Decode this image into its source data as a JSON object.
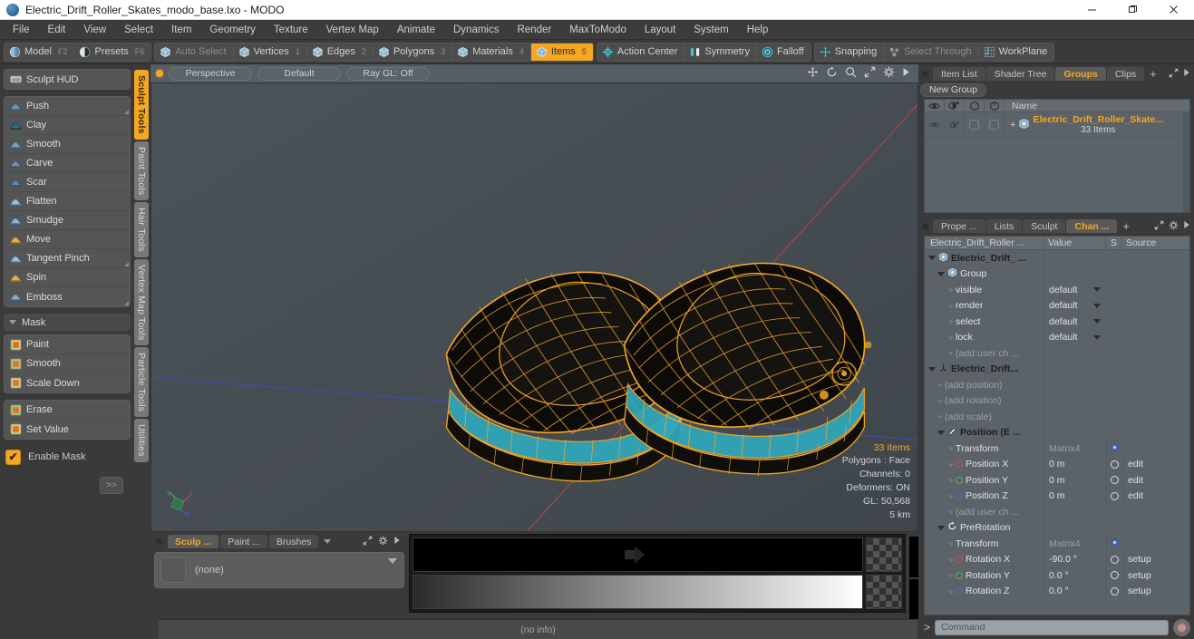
{
  "window": {
    "title": "Electric_Drift_Roller_Skates_modo_base.lxo - MODO",
    "minimize": "─",
    "maximize": "❐",
    "close": "✕"
  },
  "menubar": {
    "items": [
      "File",
      "Edit",
      "View",
      "Select",
      "Item",
      "Geometry",
      "Texture",
      "Vertex Map",
      "Animate",
      "Dynamics",
      "Render",
      "MaxToModo",
      "Layout",
      "System",
      "Help"
    ]
  },
  "toolbar": {
    "group_mode": [
      {
        "label": "Model",
        "key": "F2",
        "icon": "sphere-icon",
        "active": false
      },
      {
        "label": "Presets",
        "key": "F6",
        "icon": "half-sphere-icon",
        "active": false
      }
    ],
    "group_select": [
      {
        "label": "Auto Select",
        "key": "",
        "icon": "cube-icon",
        "active": false,
        "dim": true
      },
      {
        "label": "Vertices",
        "key": "1",
        "icon": "cube-icon",
        "active": false
      },
      {
        "label": "Edges",
        "key": "2",
        "icon": "cube-icon",
        "active": false
      },
      {
        "label": "Polygons",
        "key": "3",
        "icon": "cube-icon",
        "active": false
      },
      {
        "label": "Materials",
        "key": "4",
        "icon": "cube-icon",
        "active": false
      },
      {
        "label": "Items",
        "key": "5",
        "icon": "cube-icon",
        "active": true
      }
    ],
    "group_center": [
      {
        "label": "Action Center",
        "key": "",
        "icon": "crosshair-icon",
        "active": false
      },
      {
        "label": "Symmetry",
        "key": "",
        "icon": "mirror-icon",
        "active": false
      },
      {
        "label": "Falloff",
        "key": "",
        "icon": "target-icon",
        "active": false
      }
    ],
    "group_snap": [
      {
        "label": "Snapping",
        "key": "",
        "icon": "snap-icon",
        "active": false
      },
      {
        "label": "Select Through",
        "key": "",
        "icon": "molecule-icon",
        "active": false,
        "dim": true
      },
      {
        "label": "WorkPlane",
        "key": "",
        "icon": "grid-icon",
        "active": false
      }
    ]
  },
  "sculpt_panel": {
    "hud_label": "Sculpt HUD",
    "brushes": [
      {
        "label": "Push",
        "icon": "push-brush-icon",
        "corner": true
      },
      {
        "label": "Clay",
        "icon": "clay-brush-icon",
        "corner": false
      },
      {
        "label": "Smooth",
        "icon": "smooth-brush-icon",
        "corner": false
      },
      {
        "label": "Carve",
        "icon": "carve-brush-icon",
        "corner": false
      },
      {
        "label": "Scar",
        "icon": "scar-brush-icon",
        "corner": false
      },
      {
        "label": "Flatten",
        "icon": "flatten-brush-icon",
        "corner": false
      },
      {
        "label": "Smudge",
        "icon": "smudge-brush-icon",
        "corner": false
      },
      {
        "label": "Move",
        "icon": "move-brush-icon",
        "corner": false
      },
      {
        "label": "Tangent Pinch",
        "icon": "pinch-brush-icon",
        "corner": true
      },
      {
        "label": "Spin",
        "icon": "spin-brush-icon",
        "corner": false
      },
      {
        "label": "Emboss",
        "icon": "emboss-brush-icon",
        "corner": true
      }
    ],
    "mask_section": "Mask",
    "mask_group1": [
      {
        "label": "Paint",
        "icon": "mask-paint-icon"
      },
      {
        "label": "Smooth",
        "icon": "mask-smooth-icon"
      },
      {
        "label": "Scale Down",
        "icon": "mask-scale-icon"
      }
    ],
    "mask_group2": [
      {
        "label": "Erase",
        "icon": "mask-erase-icon"
      },
      {
        "label": "Set Value",
        "icon": "mask-setvalue-icon"
      }
    ],
    "enable_mask": {
      "label": "Enable Mask",
      "checked": true,
      "check_glyph": "✔"
    },
    "expand_label": ">>"
  },
  "vertical_tabs": [
    {
      "label": "Sculpt Tools",
      "active": true
    },
    {
      "label": "Paint Tools",
      "active": false
    },
    {
      "label": "Hair Tools",
      "active": false
    },
    {
      "label": "Vertex Map Tools",
      "active": false
    },
    {
      "label": "Particle Tools",
      "active": false
    },
    {
      "label": "Utilities",
      "active": false
    }
  ],
  "viewport": {
    "header": {
      "view_mode": "Perspective",
      "shading": "Default",
      "ray_gl": "Ray GL: Off",
      "icons": [
        "move-icon",
        "rotate-icon",
        "zoom-icon",
        "fit-icon",
        "gear-icon",
        "play-icon"
      ]
    },
    "stats": {
      "items": "33 Items",
      "polygons": "Polygons : Face",
      "channels": "Channels: 0",
      "deformers": "Deformers: ON",
      "gl": "GL: 50,568",
      "scale": "5 km"
    },
    "gizmo_axes": [
      "X",
      "Y",
      "Z"
    ],
    "colors": {
      "background": "#464d53",
      "wireframe_selected": "#f5a623",
      "wireframe_accent": "#3fc8d8",
      "axis_x": "#b34a4a",
      "axis_z": "#4a5ab3"
    },
    "model_description": "Electric Drift Roller Skates - wireframe pair of skates"
  },
  "bottom_panel": {
    "tabs": [
      {
        "label": "Sculp ...",
        "active": true
      },
      {
        "label": "Paint ...",
        "active": false
      },
      {
        "label": "Brushes",
        "active": false
      }
    ],
    "brush_value": "(none)",
    "status": "(no info)"
  },
  "right_panel": {
    "top_tabs": [
      {
        "label": "Item List",
        "active": false
      },
      {
        "label": "Shader Tree",
        "active": false
      },
      {
        "label": "Groups",
        "active": true
      },
      {
        "label": "Clips",
        "active": false
      }
    ],
    "new_group_button": "New Group",
    "group_list": {
      "columns": [
        "eye-icon",
        "render-icon",
        "select-icon",
        "lock-icon"
      ],
      "name_header": "Name",
      "rows": [
        {
          "name": "Electric_Drift_Roller_Skate...",
          "sub": "33 Items",
          "expander": "+"
        }
      ]
    },
    "bottom_tabs": [
      {
        "label": "Prope ...",
        "active": false
      },
      {
        "label": "Lists",
        "active": false
      },
      {
        "label": "Sculpt",
        "active": false
      },
      {
        "label": "Chan ...",
        "active": true
      }
    ],
    "channels": {
      "headers": [
        "Electric_Drift_Roller ...",
        "Value",
        "S",
        "Source"
      ],
      "rows": [
        {
          "indent": 1,
          "tri": "down",
          "icon": "group-icon",
          "name": "Electric_Drift_ ...",
          "value": "",
          "s": "",
          "source": "",
          "bold": true
        },
        {
          "indent": 2,
          "tri": "down",
          "icon": "group-icon",
          "name": "Group",
          "value": "",
          "s": "",
          "source": "",
          "bold": false
        },
        {
          "indent": 3,
          "tri": "dash",
          "icon": "",
          "name": "visible",
          "value": "default",
          "dropdown": true,
          "s": "",
          "source": ""
        },
        {
          "indent": 3,
          "tri": "dash",
          "icon": "",
          "name": "render",
          "value": "default",
          "dropdown": true,
          "s": "",
          "source": ""
        },
        {
          "indent": 3,
          "tri": "dash",
          "icon": "",
          "name": "select",
          "value": "default",
          "dropdown": true,
          "s": "",
          "source": ""
        },
        {
          "indent": 3,
          "tri": "dash",
          "icon": "",
          "name": "lock",
          "value": "default",
          "dropdown": true,
          "s": "",
          "source": ""
        },
        {
          "indent": 3,
          "tri": "dash",
          "icon": "",
          "name": "(add user ch ...",
          "value": "",
          "s": "",
          "source": "",
          "dim": true
        },
        {
          "indent": 1,
          "tri": "down",
          "icon": "locator-icon",
          "name": "Electric_Drift...",
          "value": "",
          "s": "",
          "source": "",
          "bold": true
        },
        {
          "indent": 2,
          "tri": "dash",
          "icon": "",
          "name": "(add position)",
          "value": "",
          "s": "",
          "source": "",
          "dim": true
        },
        {
          "indent": 2,
          "tri": "dash",
          "icon": "",
          "name": "(add rotation)",
          "value": "",
          "s": "",
          "source": "",
          "dim": true
        },
        {
          "indent": 2,
          "tri": "dash",
          "icon": "",
          "name": "(add scale)",
          "value": "",
          "s": "",
          "source": "",
          "dim": true
        },
        {
          "indent": 2,
          "tri": "down",
          "icon": "position-icon",
          "name": "Position (E ...",
          "value": "",
          "s": "",
          "source": "",
          "bold": true
        },
        {
          "indent": 3,
          "tri": "dash",
          "icon": "",
          "name": "Transform",
          "value": "Matrix4",
          "valdim": true,
          "s": "gear",
          "source": ""
        },
        {
          "indent": 3,
          "tri": "dash",
          "icon": "axis-x",
          "name": "Position X",
          "value": "0 m",
          "s": "ring",
          "source": "edit"
        },
        {
          "indent": 3,
          "tri": "dash",
          "icon": "axis-y",
          "name": "Position Y",
          "value": "0 m",
          "s": "ring",
          "source": "edit"
        },
        {
          "indent": 3,
          "tri": "dash",
          "icon": "axis-z",
          "name": "Position Z",
          "value": "0 m",
          "s": "ring",
          "source": "edit"
        },
        {
          "indent": 3,
          "tri": "dash",
          "icon": "",
          "name": "(add user ch ...",
          "value": "",
          "s": "",
          "source": "",
          "dim": true
        },
        {
          "indent": 2,
          "tri": "down",
          "icon": "prerotation-icon",
          "name": "PreRotation",
          "value": "",
          "s": "",
          "source": ""
        },
        {
          "indent": 3,
          "tri": "dash",
          "icon": "",
          "name": "Transform",
          "value": "Matrix4",
          "valdim": true,
          "s": "gear",
          "source": ""
        },
        {
          "indent": 3,
          "tri": "dash",
          "icon": "axis-x",
          "name": "Rotation X",
          "value": "-90.0 °",
          "s": "ring",
          "source": "setup"
        },
        {
          "indent": 3,
          "tri": "dash",
          "icon": "axis-y",
          "name": "Rotation Y",
          "value": "0.0 °",
          "s": "ring",
          "source": "setup"
        },
        {
          "indent": 3,
          "tri": "dash",
          "icon": "axis-z",
          "name": "Rotation Z",
          "value": "0.0 °",
          "s": "ring",
          "source": "setup"
        }
      ]
    },
    "command_bar": {
      "prompt": ">",
      "placeholder": "Command",
      "record_icon": "record-icon"
    }
  }
}
